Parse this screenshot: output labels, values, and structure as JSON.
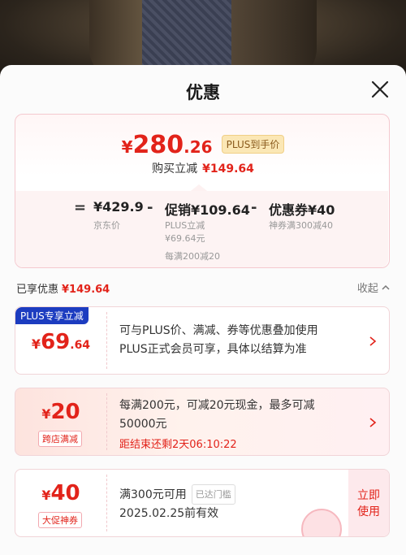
{
  "sheet": {
    "title": "优惠"
  },
  "summary": {
    "price_yen": "¥",
    "price_int": "280",
    "price_dec": ".26",
    "plus_tag": "PLUS到手价",
    "sub_label": "购买立减",
    "sub_value": "¥149.64",
    "breakdown": {
      "eq": "=",
      "jd_price": "¥429.9",
      "jd_label": "京东价",
      "minus1": "-",
      "promo_label": "促销",
      "promo_value": "¥109.64",
      "promo_detail1": "PLUS立减",
      "promo_detail2": "¥69.64元",
      "promo_detail3": "每满200减20",
      "minus2": "-",
      "coupon_label": "优惠券",
      "coupon_value": "¥40",
      "coupon_detail": "神券满300减40"
    }
  },
  "enjoyed": {
    "label": "已享优惠",
    "value": "¥149.64",
    "collapse": "收起"
  },
  "cards": [
    {
      "badge": "PLUS专享立减",
      "yen": "¥",
      "int": "69",
      "dec": ".64",
      "line1": "可与PLUS价、满减、券等优惠叠加使用",
      "line2": "PLUS正式会员可享，具体以结算为准"
    },
    {
      "yen": "¥",
      "int": "20",
      "tag": "跨店满减",
      "line1": "每满200元，可减20元现金，最多可减",
      "line2": "50000元",
      "countdown": "距结束还剩2天06:10:22"
    },
    {
      "yen": "¥",
      "int": "40",
      "tag": "大促神券",
      "line1": "满300元可用",
      "threshold": "已达门槛",
      "line2": "2025.02.25前有效",
      "use_top": "立即",
      "use_bottom": "使用"
    }
  ]
}
